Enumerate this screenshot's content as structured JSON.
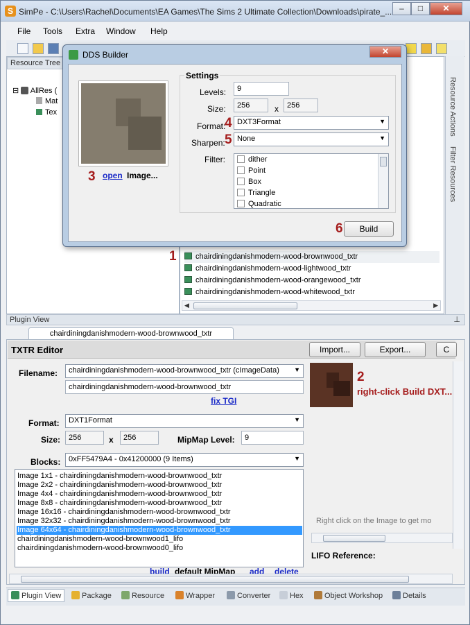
{
  "window": {
    "title": "SimPe - C:\\Users\\Rachel\\Documents\\EA Games\\The Sims 2 Ultimate Collection\\Downloads\\pirate_...",
    "app_icon": "S"
  },
  "menubar": [
    "File",
    "Tools",
    "Extra",
    "Window",
    "Help"
  ],
  "panes": {
    "resource_tree_title": "Resource Tree",
    "tree_root": "AllRes (",
    "tree_items": [
      "Mat",
      "Tex"
    ],
    "side_tabs": [
      "Resource Actions",
      "Filter Resources"
    ],
    "resources": [
      "chairdiningdanishmodern-wood-brownwood_txtr",
      "chairdiningdanishmodern-wood-lightwood_txtr",
      "chairdiningdanishmodern-wood-orangewood_txtr",
      "chairdiningdanishmodern-wood-whitewood_txtr"
    ]
  },
  "dialog": {
    "title": "DDS Builder",
    "settings_label": "Settings",
    "levels_label": "Levels:",
    "levels_value": "9",
    "size_label": "Size:",
    "size_w": "256",
    "size_x": "x",
    "size_h": "256",
    "format_label": "Format:",
    "format_value": "DXT3Format",
    "sharpen_label": "Sharpen:",
    "sharpen_value": "None",
    "filter_label": "Filter:",
    "filters": [
      "dither",
      "Point",
      "Box",
      "Triangle",
      "Quadratic"
    ],
    "open_link": "open",
    "image_label": "Image...",
    "build_button": "Build"
  },
  "annotations": {
    "n1": "1",
    "n2": "2",
    "n2_text": "right-click Build DXT...",
    "n3": "3",
    "n4": "4",
    "n5": "5",
    "n6": "6"
  },
  "plugin": {
    "header": "Plugin View",
    "doc_tab": "chairdiningdanishmodern-wood-brownwood_txtr",
    "editor_title": "TXTR Editor",
    "import_button": "Import...",
    "export_button": "Export...",
    "c_button": "C",
    "filename_label": "Filename:",
    "filename_value": "chairdiningdanishmodern-wood-brownwood_txtr (cImageData)",
    "filename_text": "chairdiningdanishmodern-wood-brownwood_txtr",
    "fix_tgi": "fix TGI",
    "format_label": "Format:",
    "format_value": "DXT1Format",
    "size_label": "Size:",
    "size_w": "256",
    "size_x": "x",
    "size_h": "256",
    "mipmap_label": "MipMap Level:",
    "mipmap_value": "9",
    "blocks_label": "Blocks:",
    "blocks_value": "0xFF5479A4 - 0x41200000 (9 Items)",
    "block_items": [
      "Image 1x1 - chairdiningdanishmodern-wood-brownwood_txtr",
      "Image 2x2 - chairdiningdanishmodern-wood-brownwood_txtr",
      "Image 4x4 - chairdiningdanishmodern-wood-brownwood_txtr",
      "Image 8x8 - chairdiningdanishmodern-wood-brownwood_txtr",
      "Image 16x16 - chairdiningdanishmodern-wood-brownwood_txtr",
      "Image 32x32 - chairdiningdanishmodern-wood-brownwood_txtr",
      "Image 64x64 - chairdiningdanishmodern-wood-brownwood_txtr",
      "chairdiningdanishmodern-wood-brownwood1_lifo",
      "chairdiningdanishmodern-wood-brownwood0_lifo"
    ],
    "selected_block": "Image 64x64 - chairdiningdanishmodern-wood-brownwood_txtr",
    "build_link": "build",
    "default_mipmap": "default MipMap",
    "add_link": "add",
    "delete_link": "delete",
    "hint": "Right click on the Image to get mo",
    "lifo_label": "LIFO Reference:"
  },
  "bottom_tabs": [
    "Plugin View",
    "Package",
    "Resource",
    "Wrapper",
    "Converter",
    "Hex",
    "Object Workshop",
    "Details"
  ],
  "colors": {
    "annotation_red": "#a51d1d",
    "link_blue": "#1a2ac8",
    "selection_blue": "#3399ff"
  }
}
